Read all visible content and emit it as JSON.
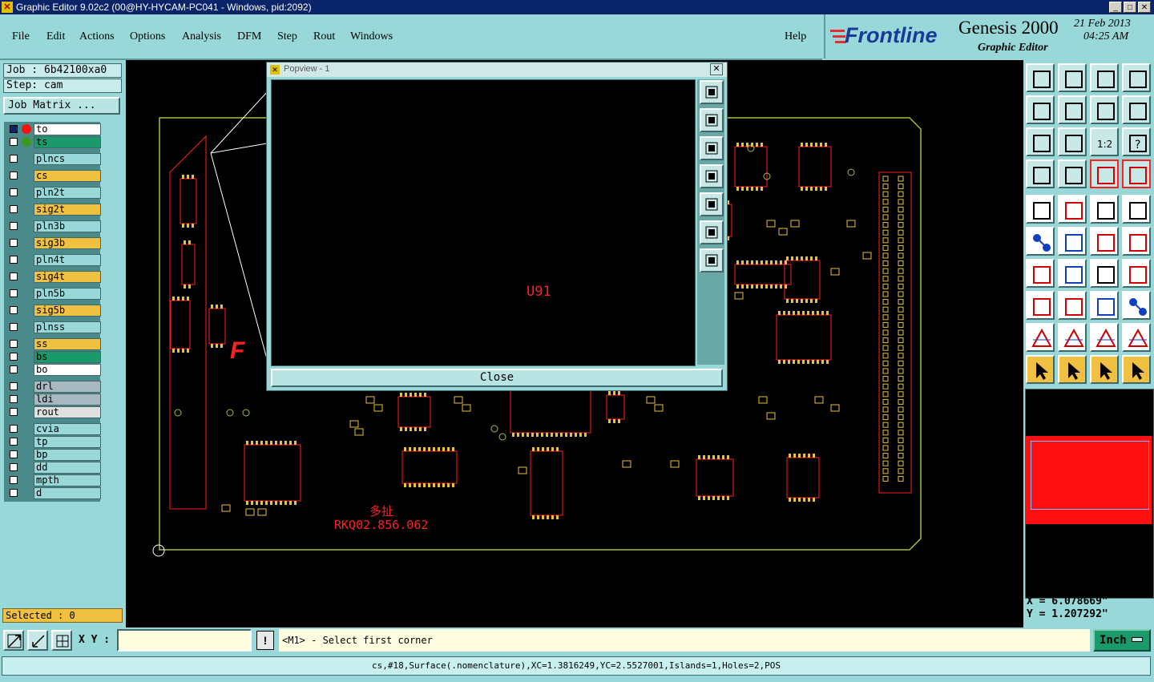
{
  "window": {
    "title": "Graphic Editor 9.02c2 (00@HY-HYCAM-PC041 - Windows, pid:2092)"
  },
  "menu": {
    "items": [
      "File",
      "Edit",
      "Actions",
      "Options",
      "Analysis",
      "DFM",
      "Step",
      "Rout",
      "Windows"
    ],
    "help": "Help"
  },
  "brand": {
    "logo": "Frontline",
    "product": "Genesis 2000",
    "subtitle": "Graphic Editor",
    "date": "21 Feb 2013",
    "time": "04:25 AM"
  },
  "job": {
    "job_label": "Job : 6b42100xa0",
    "step_label": "Step: cam",
    "matrix_button": "Job Matrix ..."
  },
  "layers": [
    {
      "name": "to",
      "color": "#ffffff"
    },
    {
      "name": "ts",
      "color": "#1a9a6a"
    },
    {
      "name": "plncs",
      "color": "#98d8d8"
    },
    {
      "name": "cs",
      "color": "#f0c040"
    },
    {
      "name": "pln2t",
      "color": "#98d8d8"
    },
    {
      "name": "sig2t",
      "color": "#f0c040"
    },
    {
      "name": "pln3b",
      "color": "#98d8d8"
    },
    {
      "name": "sig3b",
      "color": "#f0c040"
    },
    {
      "name": "pln4t",
      "color": "#98d8d8"
    },
    {
      "name": "sig4t",
      "color": "#f0c040"
    },
    {
      "name": "pln5b",
      "color": "#98d8d8"
    },
    {
      "name": "sig5b",
      "color": "#f0c040"
    },
    {
      "name": "plnss",
      "color": "#98d8d8"
    },
    {
      "name": "ss",
      "color": "#f0c040"
    },
    {
      "name": "bs",
      "color": "#1a9a6a"
    },
    {
      "name": "bo",
      "color": "#ffffff"
    },
    {
      "name": "drl",
      "color": "#a8b8c0"
    },
    {
      "name": "ldi",
      "color": "#a8b8c0"
    },
    {
      "name": "rout",
      "color": "#e0e0e0"
    },
    {
      "name": "cvia",
      "color": "#98d8d8"
    },
    {
      "name": "tp",
      "color": "#98d8d8"
    },
    {
      "name": "bp",
      "color": "#98d8d8"
    },
    {
      "name": "dd",
      "color": "#98d8d8"
    },
    {
      "name": "mpth",
      "color": "#98d8d8"
    },
    {
      "name": "d",
      "color": "#98d8d8"
    }
  ],
  "selected_label": "Selected : 0",
  "popview": {
    "title": "Popview - 1",
    "content_label": "U91",
    "close_button": "Close"
  },
  "board": {
    "label_cn": "多扯",
    "label_part": "RKQ02.856.062"
  },
  "coords": {
    "x": "X =  6.078669\"",
    "y": "Y =  1.207292\""
  },
  "statusbar": {
    "xy_label": "X Y :",
    "xy_value": "",
    "prompt": "<M1> - Select first corner",
    "units": "Inch",
    "info": "cs,#18,Surface(.nomenclature),XC=1.3816249,YC=2.5527001,Islands=1,Holes=2,POS"
  },
  "colors": {
    "pcb_red": "#ff2020",
    "pcb_yellow": "#e8c040",
    "outline_green": "#a0c040",
    "accent_teal": "#98d8d8"
  }
}
